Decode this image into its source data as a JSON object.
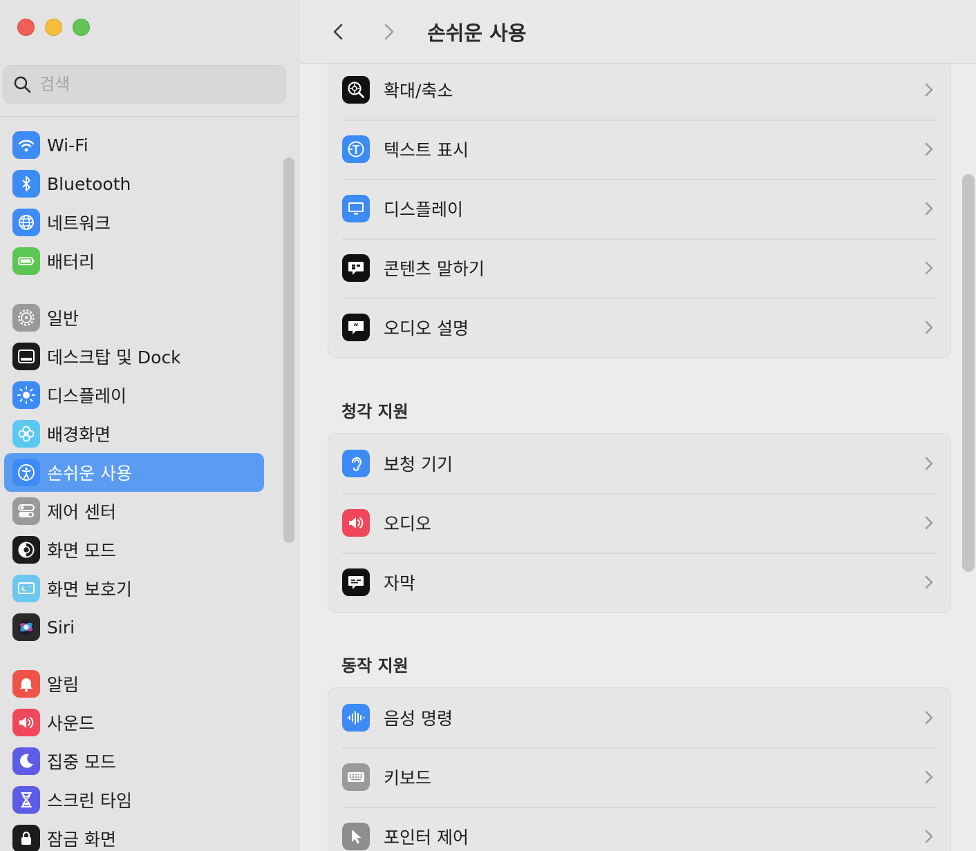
{
  "search": {
    "placeholder": "검색"
  },
  "sidebar": {
    "groups": [
      [
        {
          "label": "Wi-Fi",
          "icon": "wifi-icon",
          "color": "#3d8bf5"
        },
        {
          "label": "Bluetooth",
          "icon": "bluetooth-icon",
          "color": "#3d8bf5"
        },
        {
          "label": "네트워크",
          "icon": "globe-icon",
          "color": "#3d8bf5"
        },
        {
          "label": "배터리",
          "icon": "battery-icon",
          "color": "#5cc653"
        }
      ],
      [
        {
          "label": "일반",
          "icon": "gear-icon",
          "color": "#9a9a9a"
        },
        {
          "label": "데스크탑 및 Dock",
          "icon": "dock-icon",
          "color": "#1c1c1e"
        },
        {
          "label": "디스플레이",
          "icon": "brightness-icon",
          "color": "#3d8bf5"
        },
        {
          "label": "배경화면",
          "icon": "flower-icon",
          "color": "#5bc8f0"
        },
        {
          "label": "손쉬운 사용",
          "icon": "accessibility-icon",
          "color": "#3d8bf5",
          "selected": true
        },
        {
          "label": "제어 센터",
          "icon": "toggles-icon",
          "color": "#9a9a9a"
        },
        {
          "label": "화면 모드",
          "icon": "appearance-icon",
          "color": "#1c1c1e"
        },
        {
          "label": "화면 보호기",
          "icon": "screensaver-icon",
          "color": "#6cc7ef"
        },
        {
          "label": "Siri",
          "icon": "siri-icon",
          "color": "#2a2a2a"
        }
      ],
      [
        {
          "label": "알림",
          "icon": "bell-icon",
          "color": "#f0534a"
        },
        {
          "label": "사운드",
          "icon": "speaker-icon",
          "color": "#f0475b"
        },
        {
          "label": "집중 모드",
          "icon": "moon-icon",
          "color": "#5e5ce6"
        },
        {
          "label": "스크린 타임",
          "icon": "hourglass-icon",
          "color": "#5e5ce6"
        },
        {
          "label": "잠금 화면",
          "icon": "lock-icon",
          "color": "#1c1c1e"
        }
      ]
    ]
  },
  "header": {
    "title": "손쉬운 사용"
  },
  "vision_rows": [
    {
      "label": "확대/축소",
      "icon": "zoom-icon",
      "color": "#111111"
    },
    {
      "label": "텍스트 표시",
      "icon": "text-display-icon",
      "color": "#3d8bf5"
    },
    {
      "label": "디스플레이",
      "icon": "display-icon",
      "color": "#3d8bf5"
    },
    {
      "label": "콘텐츠 말하기",
      "icon": "spoken-content-icon",
      "color": "#111111"
    },
    {
      "label": "오디오 설명",
      "icon": "audio-description-icon",
      "color": "#111111"
    }
  ],
  "hearing": {
    "title": "청각 지원",
    "rows": [
      {
        "label": "보청 기기",
        "icon": "ear-icon",
        "color": "#3d8bf5"
      },
      {
        "label": "오디오",
        "icon": "speaker-icon",
        "color": "#f0475b"
      },
      {
        "label": "자막",
        "icon": "captions-icon",
        "color": "#111111"
      }
    ]
  },
  "motor": {
    "title": "동작 지원",
    "rows": [
      {
        "label": "음성 명령",
        "icon": "waveform-icon",
        "color": "#3d8bf5"
      },
      {
        "label": "키보드",
        "icon": "keyboard-icon",
        "color": "#9a9a9a"
      },
      {
        "label": "포인터 제어",
        "icon": "pointer-icon",
        "color": "#8e8e8e"
      }
    ]
  }
}
